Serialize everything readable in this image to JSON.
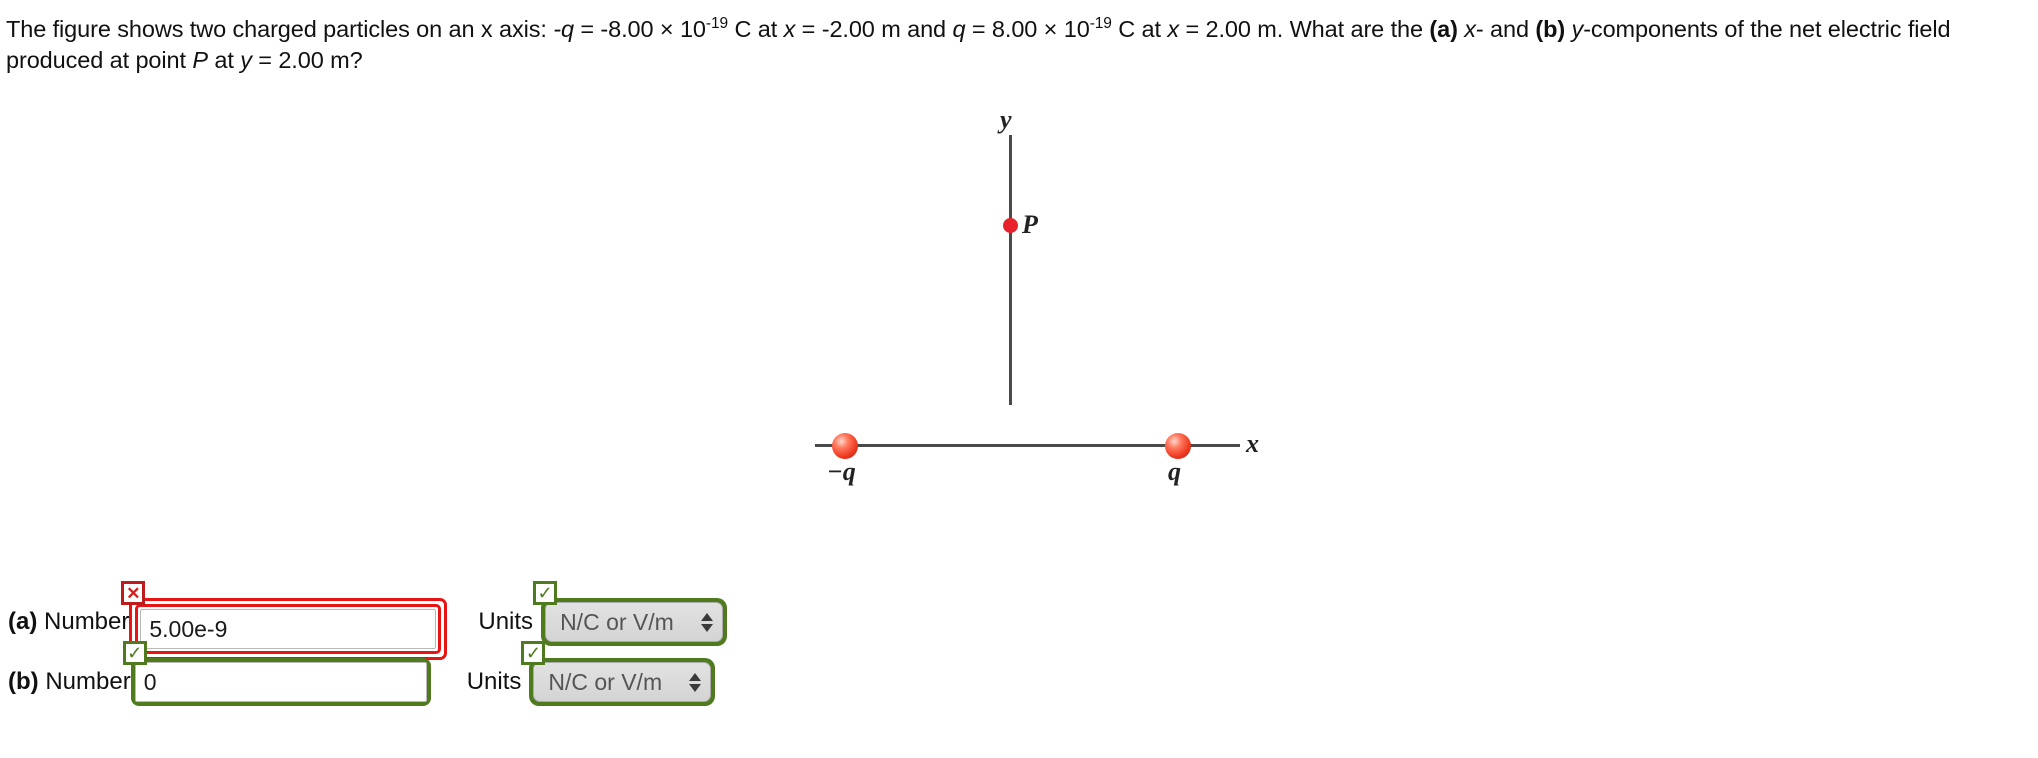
{
  "problem": {
    "lead": "The figure shows two charged particles on an x axis: ",
    "charge_neg_symbol": "-q",
    "eq1_pre": " = -8.00 × 10",
    "exp1": "-19",
    "eq1_post": " C at ",
    "x_sym_1": "x",
    "x_val_1": " = -2.00 m and ",
    "charge_pos_symbol": "q",
    "eq2_pre": " = 8.00 × 10",
    "exp2": "-19",
    "eq2_post": " C at ",
    "x_sym_2": "x",
    "x_val_2": " = 2.00 m. What are the ",
    "part_a_tag": "(a)",
    "part_a_axis": "x",
    "mid_text": "- and ",
    "part_b_tag": "(b)",
    "part_b_axis": "y",
    "tail": "-components of the net electric field produced at point ",
    "point_symbol": "P",
    "tail2": " at ",
    "y_symbol": "y",
    "tail3": " = 2.00 m?"
  },
  "figure": {
    "axis_y_label": "y",
    "axis_x_label": "x",
    "point_p_label": "P",
    "charge_negative_label": "−q",
    "charge_positive_label": "q",
    "charge_color": "#ef3b23",
    "point_color": "#e8222a",
    "axis_color": "#4a4a4a"
  },
  "answers": {
    "correct_color": "#4f7a1e",
    "incorrect_color": "#e81414",
    "rows": [
      {
        "part_tag": "(a)",
        "number_label": " Number",
        "number_value": "5.00e-9",
        "number_status": "incorrect",
        "number_badge_glyph": "✕",
        "units_label": "Units",
        "units_value": "N/C or V/m",
        "units_status": "correct",
        "units_badge_glyph": "✓"
      },
      {
        "part_tag": "(b)",
        "number_label": " Number",
        "number_value": "0",
        "number_status": "correct",
        "number_badge_glyph": "✓",
        "units_label": "Units",
        "units_value": "N/C or V/m",
        "units_status": "correct",
        "units_badge_glyph": "✓"
      }
    ]
  }
}
